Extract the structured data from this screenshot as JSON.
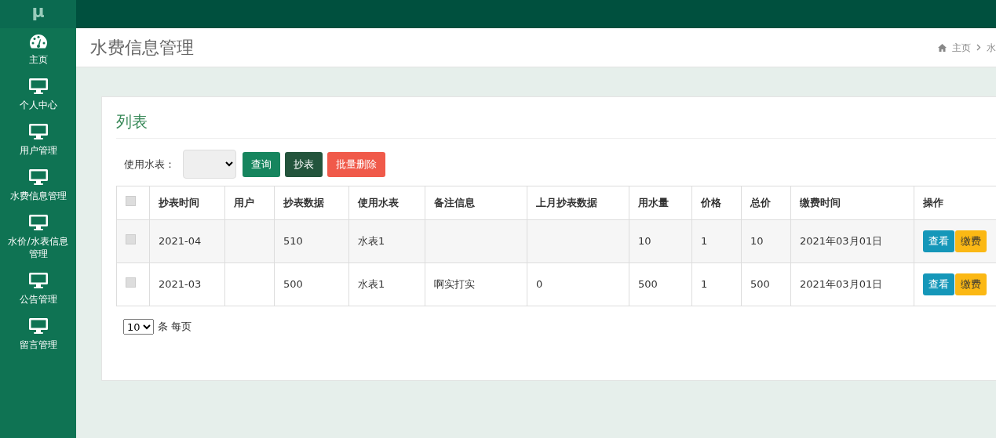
{
  "logo": "μ",
  "sidebar": {
    "items": [
      {
        "label": "主页",
        "kind": "dashboard"
      },
      {
        "label": "个人中心",
        "kind": "monitor"
      },
      {
        "label": "用户管理",
        "kind": "monitor"
      },
      {
        "label": "水费信息管理",
        "kind": "monitor"
      },
      {
        "label": "水价/水表信息管理",
        "kind": "monitor"
      },
      {
        "label": "公告管理",
        "kind": "monitor"
      },
      {
        "label": "留言管理",
        "kind": "monitor"
      }
    ]
  },
  "page_title": "水费信息管理",
  "breadcrumb": [
    "主页",
    "水"
  ],
  "card_title": "列表",
  "filter": {
    "label": "使用水表：",
    "buttons": [
      {
        "label": "查询",
        "kind": "search"
      },
      {
        "label": "抄表",
        "kind": "read"
      },
      {
        "label": "批量删除",
        "kind": "delete"
      }
    ]
  },
  "table": {
    "select_all": {
      "checked": false
    },
    "columns": [
      "抄表时间",
      "用户",
      "抄表数据",
      "使用水表",
      "备注信息",
      "上月抄表数据",
      "用水量",
      "价格",
      "总价",
      "缴费时间",
      "操作"
    ],
    "rows": [
      {
        "checked": false,
        "cells": [
          "2021-04",
          "",
          "510",
          "水表1",
          "",
          "",
          "10",
          "1",
          "10",
          "2021年03月01日"
        ],
        "actions": [
          "查看",
          "缴费"
        ]
      },
      {
        "checked": false,
        "cells": [
          "2021-03",
          "",
          "500",
          "水表1",
          "啊实打实",
          "0",
          "500",
          "1",
          "500",
          "2021年03月01日"
        ],
        "actions": [
          "查看",
          "缴费"
        ]
      }
    ]
  },
  "pagination": {
    "page_size": "10",
    "suffix": "条 每页"
  }
}
